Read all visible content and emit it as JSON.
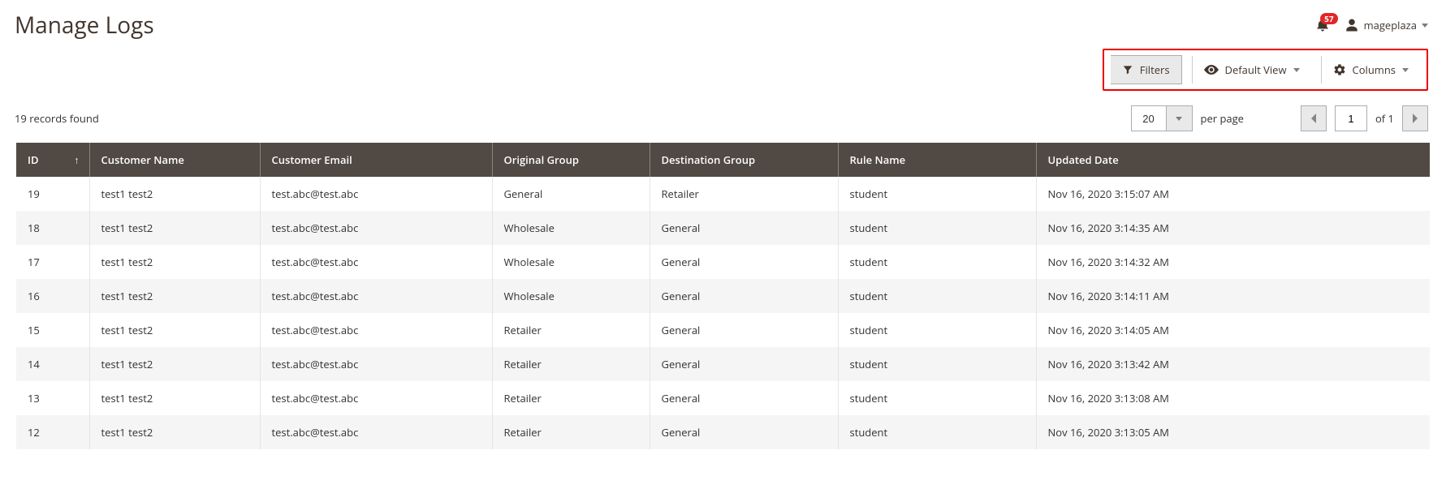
{
  "header": {
    "title": "Manage Logs",
    "notification_count": "57",
    "account_name": "mageplaza"
  },
  "toolbar": {
    "filters_label": "Filters",
    "default_view_label": "Default View",
    "columns_label": "Columns"
  },
  "controls": {
    "records_found": "19 records found",
    "per_page_value": "20",
    "per_page_label": "per page",
    "page_current": "1",
    "page_of": "of 1"
  },
  "table": {
    "columns": [
      {
        "label": "ID",
        "sorted": "asc"
      },
      {
        "label": "Customer Name"
      },
      {
        "label": "Customer Email"
      },
      {
        "label": "Original Group"
      },
      {
        "label": "Destination Group"
      },
      {
        "label": "Rule Name"
      },
      {
        "label": "Updated Date"
      }
    ],
    "rows": [
      {
        "id": "19",
        "name": "test1 test2",
        "email": "test.abc@test.abc",
        "orig": "General",
        "dest": "Retailer",
        "rule": "student",
        "date": "Nov 16, 2020 3:15:07 AM"
      },
      {
        "id": "18",
        "name": "test1 test2",
        "email": "test.abc@test.abc",
        "orig": "Wholesale",
        "dest": "General",
        "rule": "student",
        "date": "Nov 16, 2020 3:14:35 AM"
      },
      {
        "id": "17",
        "name": "test1 test2",
        "email": "test.abc@test.abc",
        "orig": "Wholesale",
        "dest": "General",
        "rule": "student",
        "date": "Nov 16, 2020 3:14:32 AM"
      },
      {
        "id": "16",
        "name": "test1 test2",
        "email": "test.abc@test.abc",
        "orig": "Wholesale",
        "dest": "General",
        "rule": "student",
        "date": "Nov 16, 2020 3:14:11 AM"
      },
      {
        "id": "15",
        "name": "test1 test2",
        "email": "test.abc@test.abc",
        "orig": "Retailer",
        "dest": "General",
        "rule": "student",
        "date": "Nov 16, 2020 3:14:05 AM"
      },
      {
        "id": "14",
        "name": "test1 test2",
        "email": "test.abc@test.abc",
        "orig": "Retailer",
        "dest": "General",
        "rule": "student",
        "date": "Nov 16, 2020 3:13:42 AM"
      },
      {
        "id": "13",
        "name": "test1 test2",
        "email": "test.abc@test.abc",
        "orig": "Retailer",
        "dest": "General",
        "rule": "student",
        "date": "Nov 16, 2020 3:13:08 AM"
      },
      {
        "id": "12",
        "name": "test1 test2",
        "email": "test.abc@test.abc",
        "orig": "Retailer",
        "dest": "General",
        "rule": "student",
        "date": "Nov 16, 2020 3:13:05 AM"
      }
    ]
  }
}
